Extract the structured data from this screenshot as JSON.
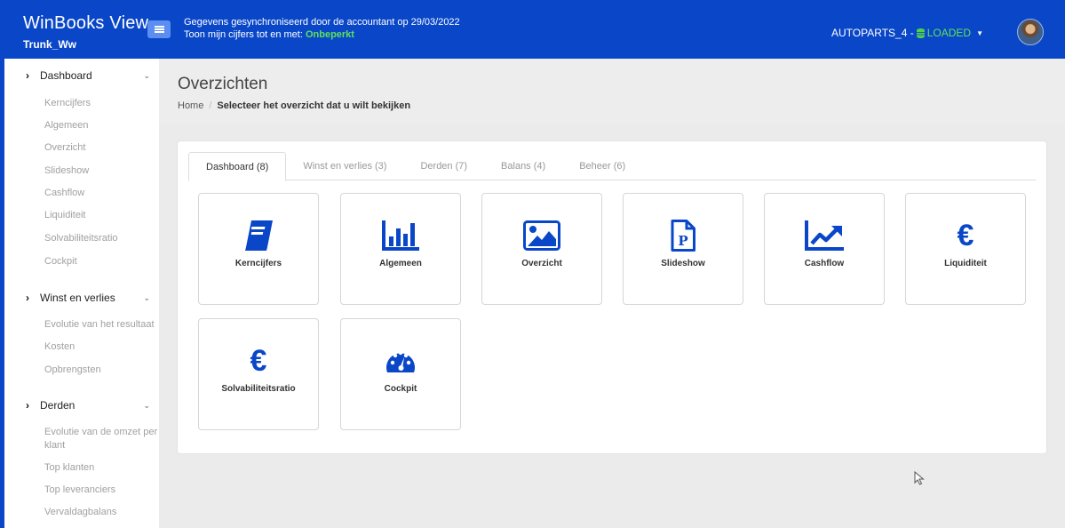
{
  "header": {
    "app_title": "WinBooks View",
    "app_subtitle": "Trunk_Ww",
    "sync_line1": "Gegevens gesynchroniseerd door de accountant op 29/03/2022",
    "sync_line2_prefix": "Toon mijn cijfers tot en met: ",
    "sync_line2_value": "Onbeperkt",
    "company": "AUTOPARTS_4 -",
    "status": "LOADED"
  },
  "sidebar": {
    "sections": [
      {
        "label": "Dashboard",
        "items": [
          "Kerncijfers",
          "Algemeen",
          "Overzicht",
          "Slideshow",
          "Cashflow",
          "Liquiditeit",
          "Solvabiliteitsratio",
          "Cockpit"
        ]
      },
      {
        "label": "Winst en verlies",
        "items": [
          "Evolutie van het resultaat",
          "Kosten",
          "Opbrengsten"
        ]
      },
      {
        "label": "Derden",
        "items": [
          "Evolutie van de omzet per klant",
          "Top klanten",
          "Top leveranciers",
          "Vervaldagbalans"
        ]
      }
    ]
  },
  "main": {
    "title": "Overzichten",
    "breadcrumb_home": "Home",
    "breadcrumb_current": "Selecteer het overzicht dat u wilt bekijken",
    "tabs": [
      "Dashboard (8)",
      "Winst en verlies (3)",
      "Derden (7)",
      "Balans (4)",
      "Beheer (6)"
    ],
    "tiles": [
      {
        "label": "Kerncijfers",
        "icon": "book-icon"
      },
      {
        "label": "Algemeen",
        "icon": "bar-chart-icon"
      },
      {
        "label": "Overzicht",
        "icon": "image-icon"
      },
      {
        "label": "Slideshow",
        "icon": "presentation-file-icon"
      },
      {
        "label": "Cashflow",
        "icon": "line-chart-icon"
      },
      {
        "label": "Liquiditeit",
        "icon": "euro-icon"
      },
      {
        "label": "Solvabiliteitsratio",
        "icon": "euro-icon"
      },
      {
        "label": "Cockpit",
        "icon": "gauge-icon"
      }
    ]
  },
  "colors": {
    "brand": "#0a47c8",
    "accent_green": "#5fe05a",
    "menu_button": "#5b8ef0"
  }
}
